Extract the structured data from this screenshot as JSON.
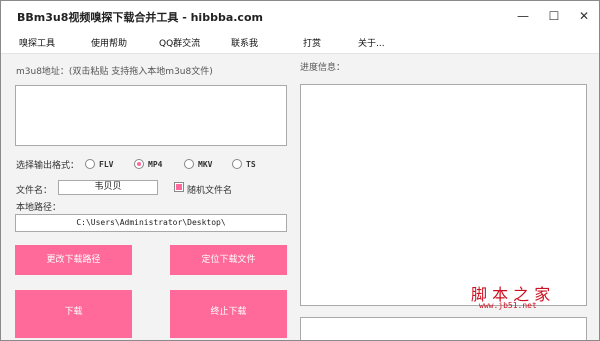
{
  "window": {
    "title": "BBm3u8视频嗅探下载合并工具 - hibbba.com",
    "minimize_icon": "minimize-icon",
    "maximize_icon": "maximize-icon",
    "close_icon": "close-icon",
    "minimize_glyph": "—",
    "maximize_glyph": "☐",
    "close_glyph": "✕"
  },
  "menu": [
    "嗅探工具",
    "使用帮助",
    "QQ群交流",
    "联系我",
    "打赏",
    "关于..."
  ],
  "form": {
    "m3u8_label": "m3u8地址：(双击粘贴 支持拖入本地m3u8文件)",
    "m3u8_value": "",
    "format_label": "选择输出格式：",
    "formats": [
      "FLV",
      "MP4",
      "MKV",
      "TS"
    ],
    "selected_format": "MP4",
    "filename_label": "文件名：",
    "filename_value": "韦贝贝",
    "random_name_label": "随机文件名",
    "random_name_checked": true,
    "path_label": "本地路径：",
    "path_value": "C:\\Users\\Administrator\\Desktop\\"
  },
  "buttons": {
    "change_path": "更改下载路径",
    "locate_file": "定位下载文件",
    "download": "下载",
    "stop": "终止下载"
  },
  "progress": {
    "label": "进度信息："
  },
  "watermark": {
    "text": "脚 本 之 家",
    "url": "www.jb51.net"
  },
  "colors": {
    "accent": "#ff6a9b"
  }
}
